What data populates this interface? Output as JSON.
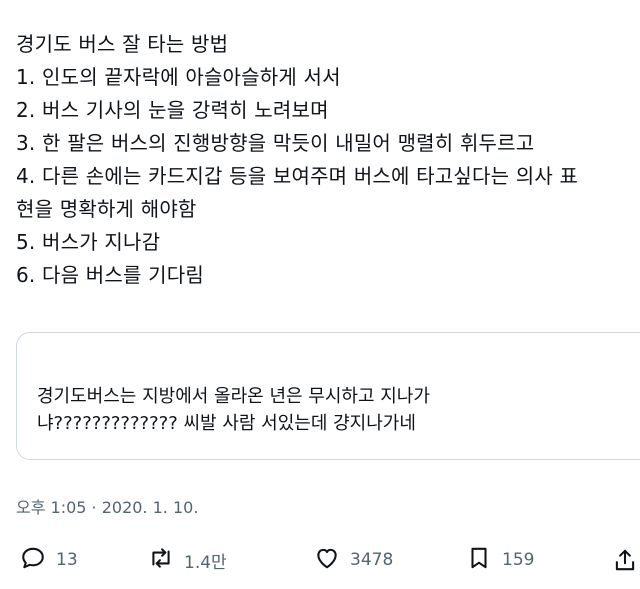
{
  "tweet": {
    "lines": [
      "경기도 버스 잘 타는 방법",
      "1. 인도의 끝자락에 아슬아슬하게 서서",
      "2. 버스 기사의 눈을 강력히 노려보며",
      "3. 한 팔은 버스의 진행방향을 막듯이 내밀어 맹렬히 휘두르고",
      "4. 다른 손에는 카드지갑 등을 보여주며 버스에 타고싶다는 의사 표",
      "현을 명확하게 해야함",
      "5. 버스가 지나감",
      "6. 다음 버스를 기다림"
    ]
  },
  "quote": {
    "lines": [
      "경기도버스는 지방에서 올라온 년은 무시하고 지나가",
      "냐????????????? 씨발 사람 서있는데 걍지나가네"
    ]
  },
  "timestamp": "오후 1:05 · 2020. 1. 10.",
  "actions": {
    "reply_count": "13",
    "retweet_count": "1.4만",
    "like_count": "3478",
    "bookmark_count": "159"
  },
  "icons": {
    "reply": "reply-icon",
    "retweet": "retweet-icon",
    "like": "heart-icon",
    "bookmark": "bookmark-icon",
    "share": "share-icon"
  },
  "colors": {
    "text": "#0f1419",
    "secondary": "#536471",
    "border": "#cfd9de"
  }
}
